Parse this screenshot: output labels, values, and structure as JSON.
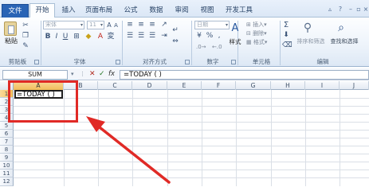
{
  "ribbon": {
    "tabs": [
      "文件",
      "开始",
      "插入",
      "页面布局",
      "公式",
      "数据",
      "审阅",
      "视图",
      "开发工具"
    ],
    "active_tab": "开始",
    "clipboard": {
      "paste_label": "粘贴",
      "group_label": "剪贴板"
    },
    "font": {
      "name": "宋体",
      "size": "11",
      "group_label": "字体"
    },
    "alignment": {
      "group_label": "对齐方式"
    },
    "number": {
      "format": "日期",
      "percent": "%",
      "comma": ",",
      "group_label": "数字"
    },
    "styles": {
      "label": "样式",
      "group_label": "单元格",
      "insert": "插入",
      "delete": "删除",
      "format": "格式"
    },
    "editing": {
      "sum_symbol": "Σ",
      "sort_label": "排序和筛选",
      "find_label": "查找和选择",
      "group_label": "编辑"
    }
  },
  "formula_bar": {
    "name_box": "SUM",
    "cancel": "✕",
    "enter": "✓",
    "fx": "fx",
    "content": "=TODAY ( )"
  },
  "grid": {
    "columns": [
      "A",
      "B",
      "C",
      "D",
      "E",
      "F",
      "G",
      "H",
      "I",
      "J"
    ],
    "rows": [
      "1",
      "2",
      "3",
      "4",
      "5",
      "6",
      "7",
      "8",
      "9",
      "10",
      "11",
      "12"
    ],
    "active_cell_value": "=TODAY ( )"
  },
  "colors": {
    "file_tab": "#2a64b5",
    "annotation_red": "#e02a26",
    "header_selected": "#f1bd5a"
  }
}
